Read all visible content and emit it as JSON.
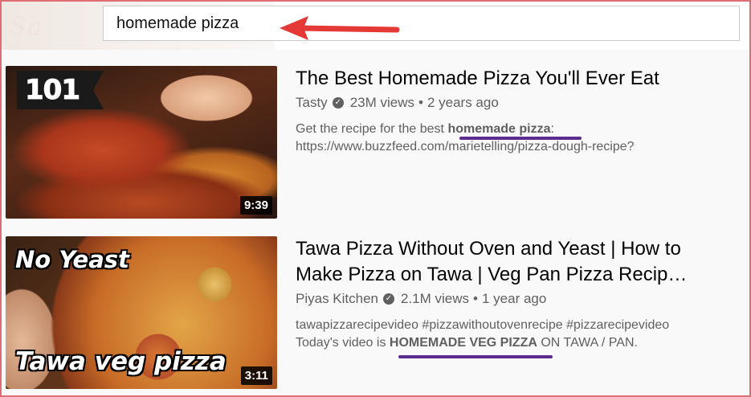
{
  "search": {
    "value": "homemade pizza"
  },
  "colors": {
    "annotation_arrow": "#e53935",
    "annotation_underline": "#5b2c8f"
  },
  "results": [
    {
      "thumb_badge": "101",
      "duration": "9:39",
      "title": "The Best Homemade Pizza You'll Ever Eat",
      "channel": "Tasty",
      "views": "23M views",
      "age": "2 years ago",
      "desc_pre": "Get the recipe for the best ",
      "desc_bold": "homemade pizza",
      "desc_post": ":",
      "desc_line2": "https://www.buzzfeed.com/marietelling/pizza-dough-recipe?"
    },
    {
      "thumb_text_top": "No Yeast",
      "thumb_text_bottom": "Tawa veg pizza",
      "duration": "3:11",
      "title_line1": "Tawa Pizza Without Oven and Yeast | How to",
      "title_line2": "Make Pizza on Tawa | Veg Pan Pizza Recip…",
      "channel": "Piyas Kitchen",
      "views": "2.1M views",
      "age": "1 year ago",
      "desc_line1": "tawapizzarecipevideo #pizzawithoutovenrecipe #pizzarecipevideo",
      "desc_pre": "Today's video is ",
      "desc_bold": "HOMEMADE VEG PIZZA",
      "desc_post": " ON TAWA / PAN."
    }
  ]
}
